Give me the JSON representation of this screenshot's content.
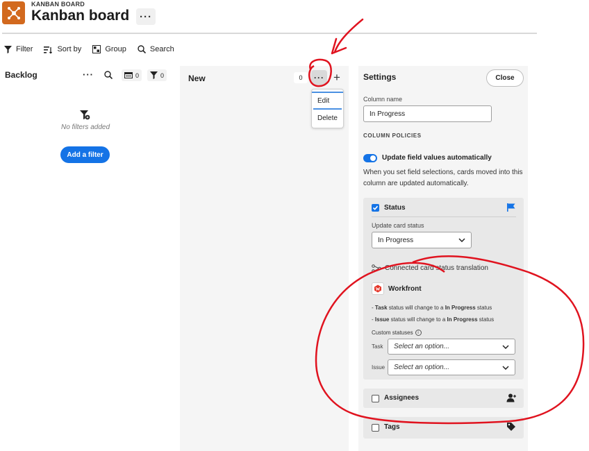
{
  "header": {
    "overline": "KANBAN BOARD",
    "title": "Kanban board",
    "more_label": "···",
    "icon": "hub-network-icon",
    "icon_color": "#d2691e"
  },
  "toolbar": {
    "filter": "Filter",
    "sort": "Sort by",
    "group": "Group",
    "search": "Search"
  },
  "backlog": {
    "title": "Backlog",
    "more_label": "···",
    "cards_count": "0",
    "filters_count": "0",
    "empty_text": "No filters added",
    "add_filter": "Add a filter"
  },
  "new_column": {
    "title": "New",
    "count": "0",
    "more_label": "···",
    "add_label": "+",
    "menu": {
      "edit": "Edit",
      "delete": "Delete"
    }
  },
  "settings": {
    "title": "Settings",
    "close": "Close",
    "column_name_label": "Column name",
    "column_name_value": "In Progress",
    "policies_heading": "COLUMN POLICIES",
    "toggle_label": "Update field values automatically",
    "toggle_on": true,
    "description": "When you set field selections, cards moved into this column are updated automatically.",
    "status": {
      "label": "Status",
      "checked": true,
      "update_label": "Update card status",
      "selected": "In Progress",
      "connected_label": "Connected card status translation",
      "workfront_label": "Workfront",
      "rule_task": {
        "prefix": "- ",
        "subject": "Task",
        "middle": " status will change to a ",
        "status": "In Progress",
        "suffix": " status"
      },
      "rule_issue": {
        "prefix": "- ",
        "subject": "Issue",
        "middle": " status will change to a ",
        "status": "In Progress",
        "suffix": " status"
      },
      "custom_statuses_label": "Custom statuses",
      "task_label": "Task",
      "issue_label": "Issue",
      "task_placeholder": "Select an option...",
      "issue_placeholder": "Select an option..."
    },
    "assignees_label": "Assignees",
    "tags_label": "Tags"
  },
  "colors": {
    "accent": "#1473e6",
    "annotation": "#e0131f"
  }
}
